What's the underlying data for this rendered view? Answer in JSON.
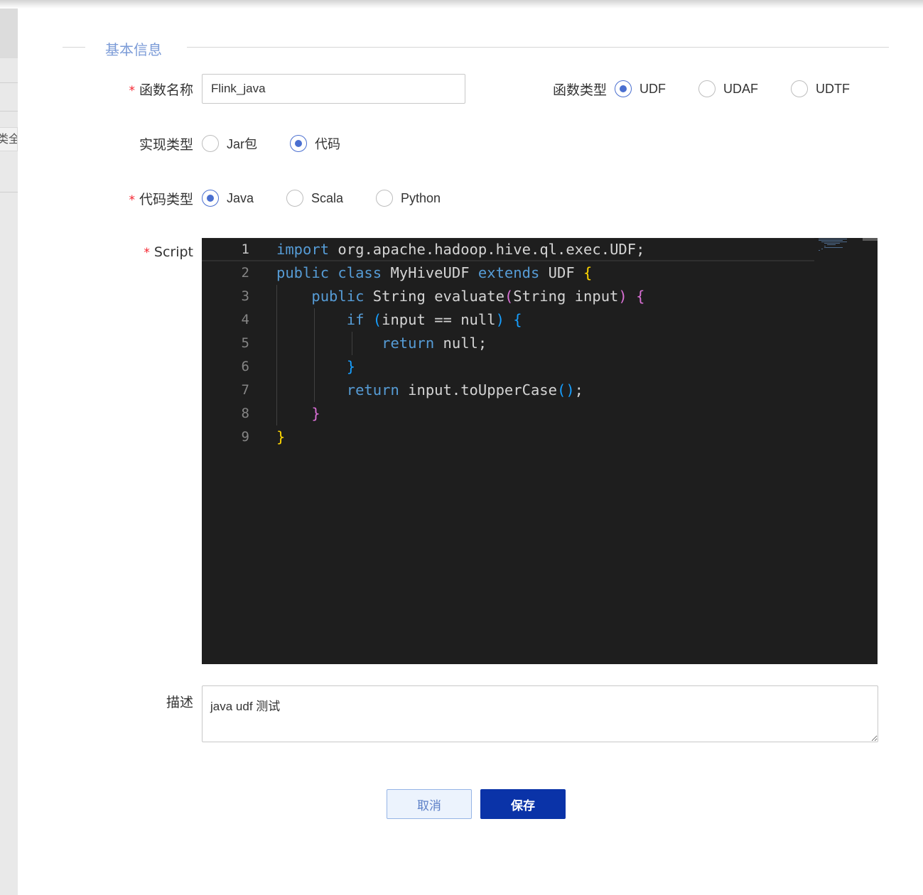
{
  "backdrop": {
    "chip_text": "类全"
  },
  "section": {
    "title": "基本信息"
  },
  "form": {
    "function_name": {
      "label": "函数名称",
      "required_mark": "*",
      "value": "Flink_java"
    },
    "function_type": {
      "label": "函数类型",
      "options": [
        {
          "label": "UDF",
          "checked": true
        },
        {
          "label": "UDAF",
          "checked": false
        },
        {
          "label": "UDTF",
          "checked": false
        }
      ]
    },
    "impl_type": {
      "label": "实现类型",
      "options": [
        {
          "label": "Jar包",
          "checked": false
        },
        {
          "label": "代码",
          "checked": true
        }
      ]
    },
    "code_type": {
      "label": "代码类型",
      "required_mark": "*",
      "options": [
        {
          "label": "Java",
          "checked": true
        },
        {
          "label": "Scala",
          "checked": false
        },
        {
          "label": "Python",
          "checked": false
        }
      ]
    },
    "script": {
      "label": "Script",
      "required_mark": "*",
      "line_numbers": [
        "1",
        "2",
        "3",
        "4",
        "5",
        "6",
        "7",
        "8",
        "9"
      ],
      "lines": [
        "import org.apache.hadoop.hive.ql.exec.UDF;",
        "public class MyHiveUDF extends UDF {",
        "    public String evaluate(String input) {",
        "        if (input == null) {",
        "            return null;",
        "        }",
        "        return input.toUpperCase();",
        "    }",
        "}"
      ],
      "theme_colors": {
        "background": "#1e1e1e",
        "keyword": "#569cd6",
        "text": "#d4d4d4",
        "bracket_level1": "#ffd700",
        "bracket_level2": "#da70d6",
        "bracket_level3": "#179fff"
      }
    },
    "description": {
      "label": "描述",
      "value": "java udf 测试"
    }
  },
  "actions": {
    "cancel_label": "取消",
    "save_label": "保存"
  },
  "colors": {
    "accent": "#4a6fd0",
    "section_title": "#7b9bd7",
    "required": "#f5222d",
    "save_button": "#0a33a8",
    "cancel_button_bg": "#ecf3fd"
  }
}
